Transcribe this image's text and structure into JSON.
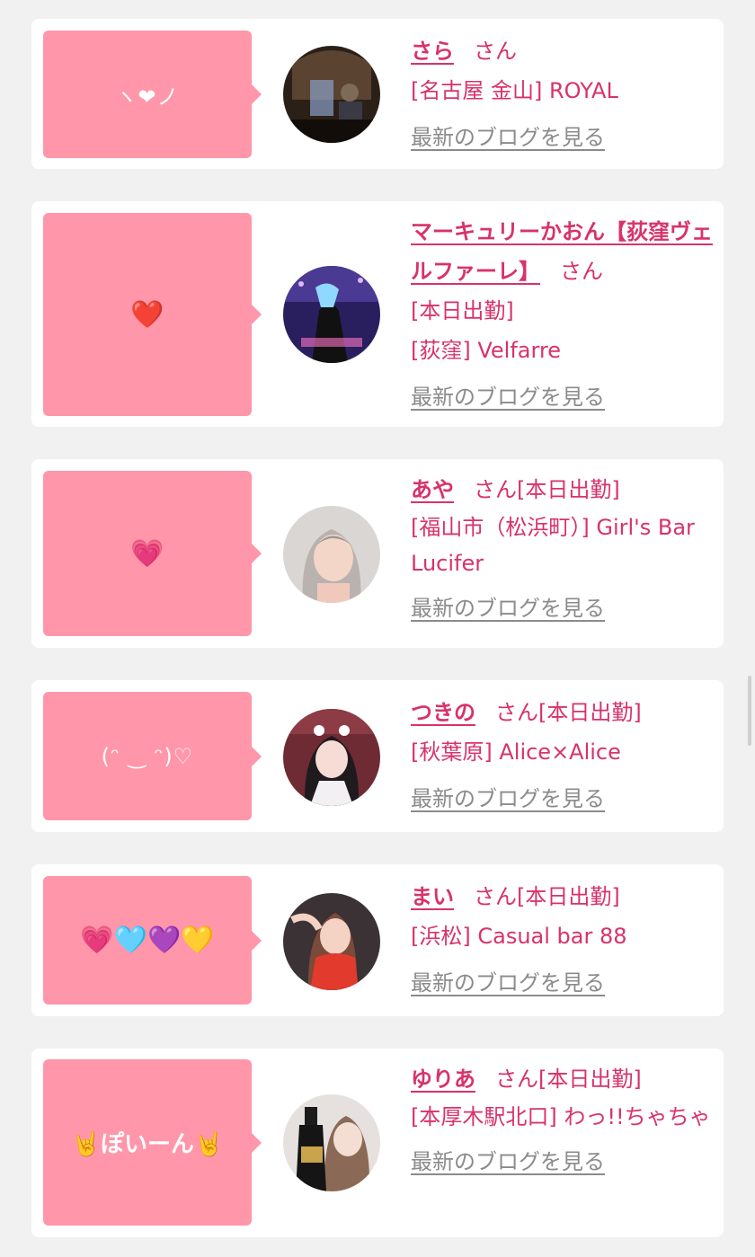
{
  "colors": {
    "accent": "#d9326a",
    "bubble": "#ff96a9",
    "background": "#f1f1f1",
    "card": "#ffffff",
    "blog_link": "#8b8b8b"
  },
  "cards": [
    {
      "message": "ヽ❤ノ",
      "name": "さら",
      "honorific": "さん",
      "lines": [
        "[名古屋 金山] ROYAL"
      ],
      "blog_label": "最新のブログを見る",
      "avatar_icon": "avatar-photo-dark-bar"
    },
    {
      "message": "❤️",
      "name": "マーキュリーかおん【荻窪ヴェルファーレ】",
      "honorific": "さん",
      "lines": [
        "[本日出勤]",
        "[荻窪] Velfarre"
      ],
      "blog_label": "最新のブログを見る",
      "avatar_icon": "avatar-photo-purple-bar"
    },
    {
      "message": "💗",
      "name": "あや",
      "honorific": "さん",
      "status": "[本日出勤]",
      "lines": [
        "[福山市（松浜町）] Girl's Bar Lucifer"
      ],
      "blog_label": "最新のブログを見る",
      "avatar_icon": "avatar-photo-portrait"
    },
    {
      "message": "(ᵔ ‿ ᵔ)♡",
      "name": "つきの",
      "honorific": "さん",
      "status": "[本日出勤]",
      "lines": [
        "[秋葉原] Alice×Alice"
      ],
      "blog_label": "最新のブログを見る",
      "avatar_icon": "avatar-photo-maid"
    },
    {
      "message": "💗🩵💜💛",
      "name": "まい",
      "honorific": "さん",
      "status": "[本日出勤]",
      "lines": [
        "[浜松] Casual bar 88"
      ],
      "blog_label": "最新のブログを見る",
      "avatar_icon": "avatar-photo-red-dress"
    },
    {
      "message": "🤘ぽいーん🤘",
      "name": "ゆりあ",
      "honorific": "さん",
      "status": "[本日出勤]",
      "lines": [
        "[本厚木駅北口] わっ!!ちゃちゃ"
      ],
      "blog_label": "最新のブログを見る",
      "avatar_icon": "avatar-photo-champagne"
    }
  ]
}
